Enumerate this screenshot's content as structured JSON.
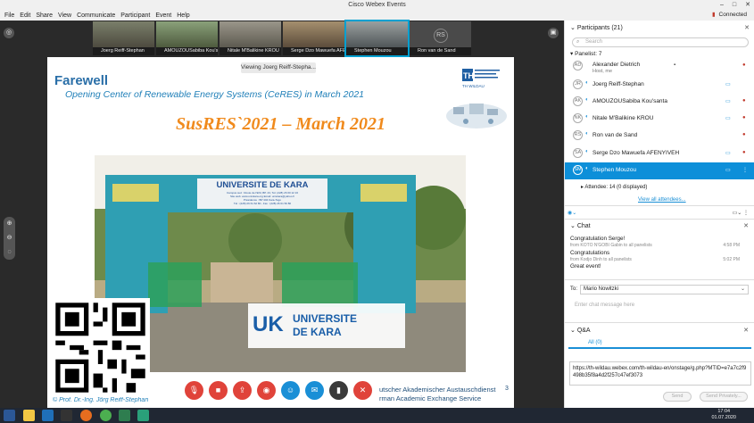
{
  "app": {
    "title": "Cisco Webex Events",
    "connected": "Connected"
  },
  "menu": [
    "File",
    "Edit",
    "Share",
    "View",
    "Communicate",
    "Participant",
    "Event",
    "Help"
  ],
  "thumbnails": [
    {
      "name": "Joerg Reiff-Stephan"
    },
    {
      "name": "AMOUZOUSabiba Kou'santa"
    },
    {
      "name": "Nitale M'Balikine KROU"
    },
    {
      "name": "Serge Dzo Mawuefa AFEN..."
    },
    {
      "name": "Stephen Mouzou"
    },
    {
      "name": "Ron van de Sand",
      "initials": "RS"
    }
  ],
  "viewing": "Viewing Joerg Reiff-Stepha...",
  "slide": {
    "heading": "Farewell",
    "subtitle": "Opening Center of Renewable Energy Systems (CeRES) in March 2021",
    "event_title": "SusRES`2021 – March 2021",
    "gate_sign": "UNIVERSITE DE KARA",
    "gate_sub1": "Campus sud : Route de l'ENI, BP. 43, Tél. (228) 26 60 12 16",
    "gate_sub2": "Site web: www.univkara.org Email: univkara@yahoo.fr",
    "gate_sub3": "Présidence : BP 404 Kara-Togo",
    "gate_sub4": "Tél : (228) 26 61 62 80 - Fax : (228) 26 61 50 80",
    "uk_logo": "UK",
    "uk_name_1": "UNIVERSITE",
    "uk_name_2": "DE KARA",
    "author": "© Prof. Dr.-Ing. Jörg Reiff-Stephan",
    "daad_line1": "utscher Akademischer Austauschdienst",
    "daad_line2": "rman Academic Exchange Service",
    "page_number": "3",
    "logo_text": "TH WILDAU"
  },
  "panel": {
    "participants_title": "Participants (21)",
    "search_placeholder": "Search",
    "panelist_header": "Panelist: 7",
    "panelists": [
      {
        "initials": "AD",
        "name": "Alexander Dietrich",
        "sub": "Host, me"
      },
      {
        "initials": "JR",
        "name": "Joerg Reiff-Stephan"
      },
      {
        "initials": "AK",
        "name": "AMOUZOUSabiba Kou'santa"
      },
      {
        "initials": "NK",
        "name": "Nitale M'Balikine KROU"
      },
      {
        "initials": "RS",
        "name": "Ron van de Sand"
      },
      {
        "initials": "SA",
        "name": "Serge Dzo Mawuefa AFENYIVEH"
      },
      {
        "initials": "SM",
        "name": "Stephen Mouzou"
      }
    ],
    "attendees": "Attendee: 14 (0 displayed)",
    "view_all": "View all attendees..."
  },
  "chat": {
    "title": "Chat",
    "messages": [
      {
        "text": "Congratulation Serge!",
        "meta": "from KOTO N'GOBI Gabin to all panelists",
        "time": "4:58 PM"
      },
      {
        "text": "Congratulations",
        "meta": "from Kodjo Dinh to all panelists",
        "time": "5:02 PM"
      },
      {
        "text": "Great event!"
      }
    ],
    "to_label": "To:",
    "to_value": "Mario Nowitzki",
    "placeholder": "Enter chat message here"
  },
  "qa": {
    "title": "Q&A",
    "tab": "All (0)",
    "text": "https://th-wildau.webex.com/th-wildau-en/onstage/g.php?MTID=e7a7c2f9498b35f8a4d2f257c47ef3073",
    "send": "Send",
    "send_privately": "Send Privately..."
  },
  "taskbar": {
    "time": "17:04",
    "date": "01.07.2020"
  }
}
